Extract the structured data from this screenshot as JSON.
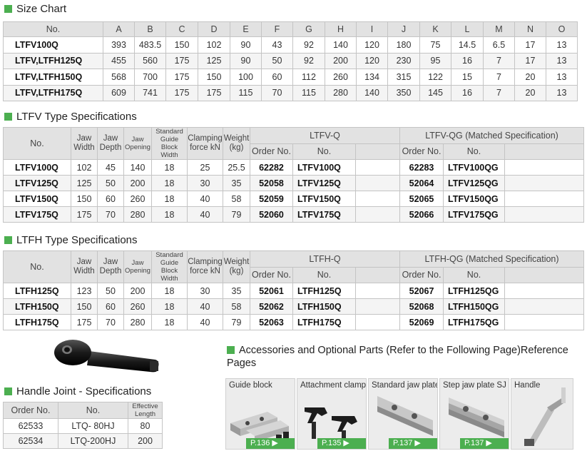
{
  "size_chart": {
    "title": "Size Chart",
    "headers": [
      "No.",
      "A",
      "B",
      "C",
      "D",
      "E",
      "F",
      "G",
      "H",
      "I",
      "J",
      "K",
      "L",
      "M",
      "N",
      "O"
    ],
    "rows": [
      [
        "LTFV100Q",
        "393",
        "483.5",
        "150",
        "102",
        "90",
        "43",
        "92",
        "140",
        "120",
        "180",
        "75",
        "14.5",
        "6.5",
        "17",
        "13"
      ],
      [
        "LTFV,LTFH125Q",
        "455",
        "560",
        "175",
        "125",
        "90",
        "50",
        "92",
        "200",
        "120",
        "230",
        "95",
        "16",
        "7",
        "17",
        "13"
      ],
      [
        "LTFV,LTFH150Q",
        "568",
        "700",
        "175",
        "150",
        "100",
        "60",
        "112",
        "260",
        "134",
        "315",
        "122",
        "15",
        "7",
        "20",
        "13"
      ],
      [
        "LTFV,LTFH175Q",
        "609",
        "741",
        "175",
        "175",
        "115",
        "70",
        "115",
        "280",
        "140",
        "350",
        "145",
        "16",
        "7",
        "20",
        "13"
      ]
    ]
  },
  "ltfv": {
    "title": "LTFV Type Specifications",
    "h_no": "No.",
    "h_jaw_width": "Jaw Width",
    "h_jaw_depth": "Jaw Depth",
    "h_jaw_opening": "Jaw Opening",
    "h_guide": "Standard Guide Block Width",
    "h_clamp": "Clamping force kN",
    "h_weight": "Weight (kg)",
    "group1": "LTFV-Q",
    "group2": "LTFV-QG (Matched Specification)",
    "h_order": "Order No.",
    "h_no2": "No.",
    "rows": [
      [
        "LTFV100Q",
        "102",
        "45",
        "140",
        "18",
        "25",
        "25.5",
        "62282",
        "LTFV100Q",
        "62283",
        "LTFV100QG"
      ],
      [
        "LTFV125Q",
        "125",
        "50",
        "200",
        "18",
        "30",
        "35",
        "52058",
        "LTFV125Q",
        "52064",
        "LTFV125QG"
      ],
      [
        "LTFV150Q",
        "150",
        "60",
        "260",
        "18",
        "40",
        "58",
        "52059",
        "LTFV150Q",
        "52065",
        "LTFV150QG"
      ],
      [
        "LTFV175Q",
        "175",
        "70",
        "280",
        "18",
        "40",
        "79",
        "52060",
        "LTFV175Q",
        "52066",
        "LTFV175QG"
      ]
    ]
  },
  "ltfh": {
    "title": "LTFH Type Specifications",
    "h_no": "No.",
    "h_jaw_width": "Jaw Width",
    "h_jaw_depth": "Jaw Depth",
    "h_jaw_opening": "Jaw Opening",
    "h_guide": "Standard Guide Block Width",
    "h_clamp": "Clamping force kN",
    "h_weight": "Weight (kg)",
    "group1": "LTFH-Q",
    "group2": "LTFH-QG (Matched Specification)",
    "h_order": "Order No.",
    "h_no2": "No.",
    "rows": [
      [
        "LTFH125Q",
        "123",
        "50",
        "200",
        "18",
        "30",
        "35",
        "52061",
        "LTFH125Q",
        "52067",
        "LTFH125QG"
      ],
      [
        "LTFH150Q",
        "150",
        "60",
        "260",
        "18",
        "40",
        "58",
        "52062",
        "LTFH150Q",
        "52068",
        "LTFH150QG"
      ],
      [
        "LTFH175Q",
        "175",
        "70",
        "280",
        "18",
        "40",
        "79",
        "52063",
        "LTFH175Q",
        "52069",
        "LTFH175QG"
      ]
    ]
  },
  "handle": {
    "title": "Handle Joint - Specifications",
    "h_order": "Order No.",
    "h_no": "No.",
    "h_len": "Effective Length",
    "rows": [
      [
        "62533",
        "LTQ- 80HJ",
        "80"
      ],
      [
        "62534",
        "LTQ-200HJ",
        "200"
      ]
    ]
  },
  "accessories": {
    "title": "Accessories and Optional Parts (Refer to the Following Page)Reference Pages",
    "cards": [
      {
        "label": "Guide block",
        "page": "P.136 ▶"
      },
      {
        "label": "Attachment clamp",
        "page": "P.135 ▶"
      },
      {
        "label": "Standard jaw plate JA",
        "page": "P.137 ▶"
      },
      {
        "label": "Step jaw plate SJ",
        "page": "P.137 ▶"
      },
      {
        "label": "Handle",
        "page": ""
      }
    ]
  },
  "colors": {
    "accent": "#4caf50",
    "header_bg": "#e2e2e2",
    "alt_row": "#f4f4f4"
  },
  "icons": [
    "handle-joint-image",
    "guide-block-image",
    "attachment-clamp-image",
    "standard-jaw-plate-image",
    "step-jaw-plate-image",
    "handle-image"
  ]
}
